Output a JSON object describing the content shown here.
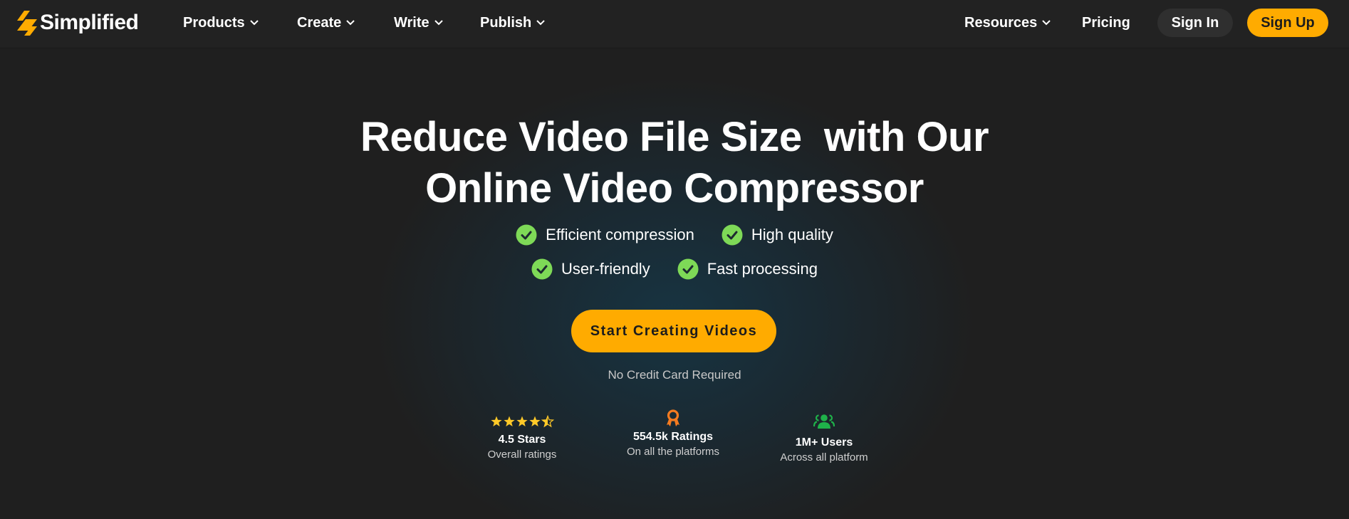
{
  "brand": {
    "name": "Simplified",
    "accent_color": "#ffab00"
  },
  "nav": {
    "items": [
      {
        "label": "Products",
        "has_dropdown": true
      },
      {
        "label": "Create",
        "has_dropdown": true
      },
      {
        "label": "Write",
        "has_dropdown": true
      },
      {
        "label": "Publish",
        "has_dropdown": true
      }
    ],
    "right_items": [
      {
        "label": "Resources",
        "has_dropdown": true
      },
      {
        "label": "Pricing",
        "has_dropdown": false
      }
    ],
    "sign_in_label": "Sign In",
    "sign_up_label": "Sign Up"
  },
  "hero": {
    "headline_line1": "Reduce Video File Size  with Our",
    "headline_line2": "Online Video Compressor",
    "features_row1": [
      {
        "label": "Efficient compression",
        "icon": "check-circle-icon"
      },
      {
        "label": "High quality",
        "icon": "check-circle-icon"
      }
    ],
    "features_row2": [
      {
        "label": "User-friendly",
        "icon": "check-circle-icon"
      },
      {
        "label": "Fast processing",
        "icon": "check-circle-icon"
      }
    ],
    "check_color": "#7ed957",
    "cta_label": "Start Creating Videos",
    "note": "No Credit Card Required"
  },
  "stats": [
    {
      "icon": "star-rating-icon",
      "title": "4.5 Stars",
      "subtitle": "Overall ratings",
      "rating": 4.5,
      "max_rating": 5,
      "icon_color": "#ffc928"
    },
    {
      "icon": "award-ribbon-icon",
      "title": "554.5k Ratings",
      "subtitle": "On all the platforms",
      "icon_color": "#f57b20"
    },
    {
      "icon": "users-group-icon",
      "title": "1M+ Users",
      "subtitle": "Across all platform",
      "icon_color": "#1fb24a"
    }
  ]
}
